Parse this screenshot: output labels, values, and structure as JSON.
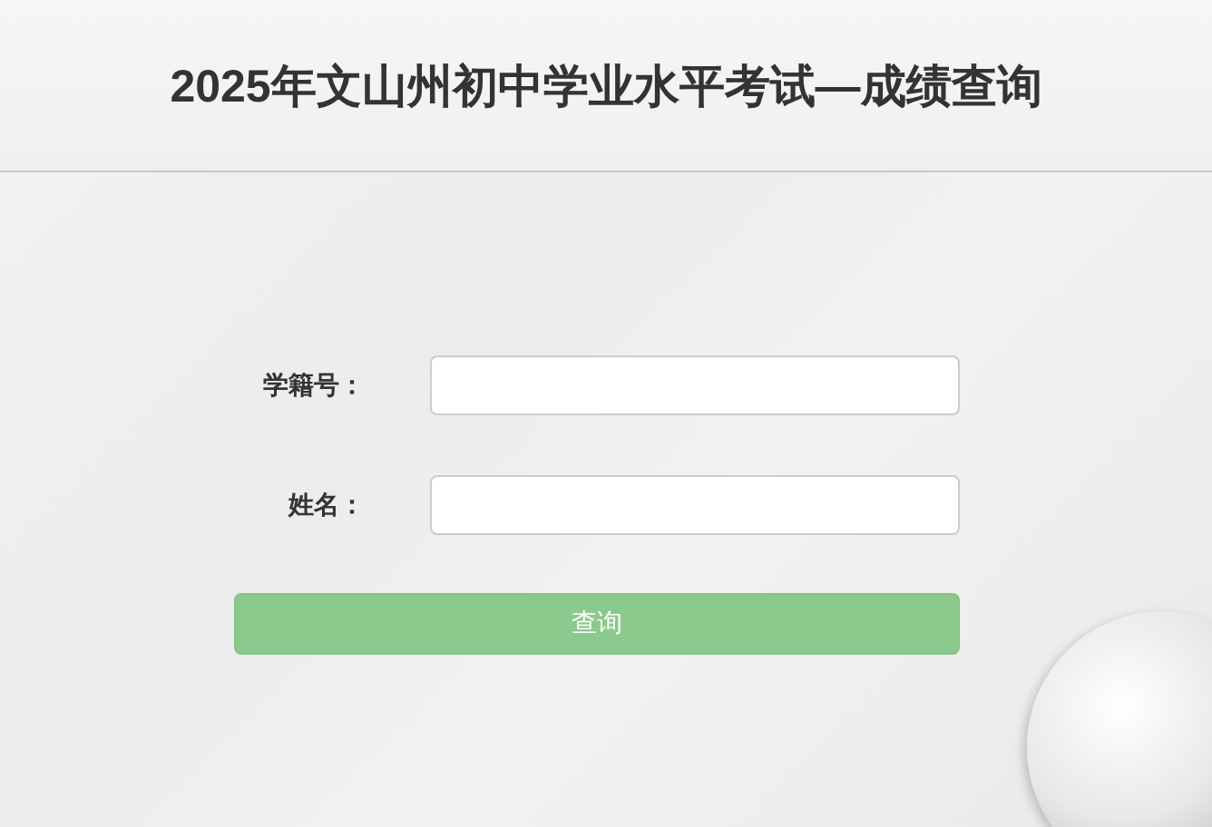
{
  "header": {
    "title": "2025年文山州初中学业水平考试—成绩查询"
  },
  "form": {
    "fields": [
      {
        "label": "学籍号："
      },
      {
        "label": "姓名："
      }
    ],
    "submit": {
      "label": "查询"
    }
  }
}
